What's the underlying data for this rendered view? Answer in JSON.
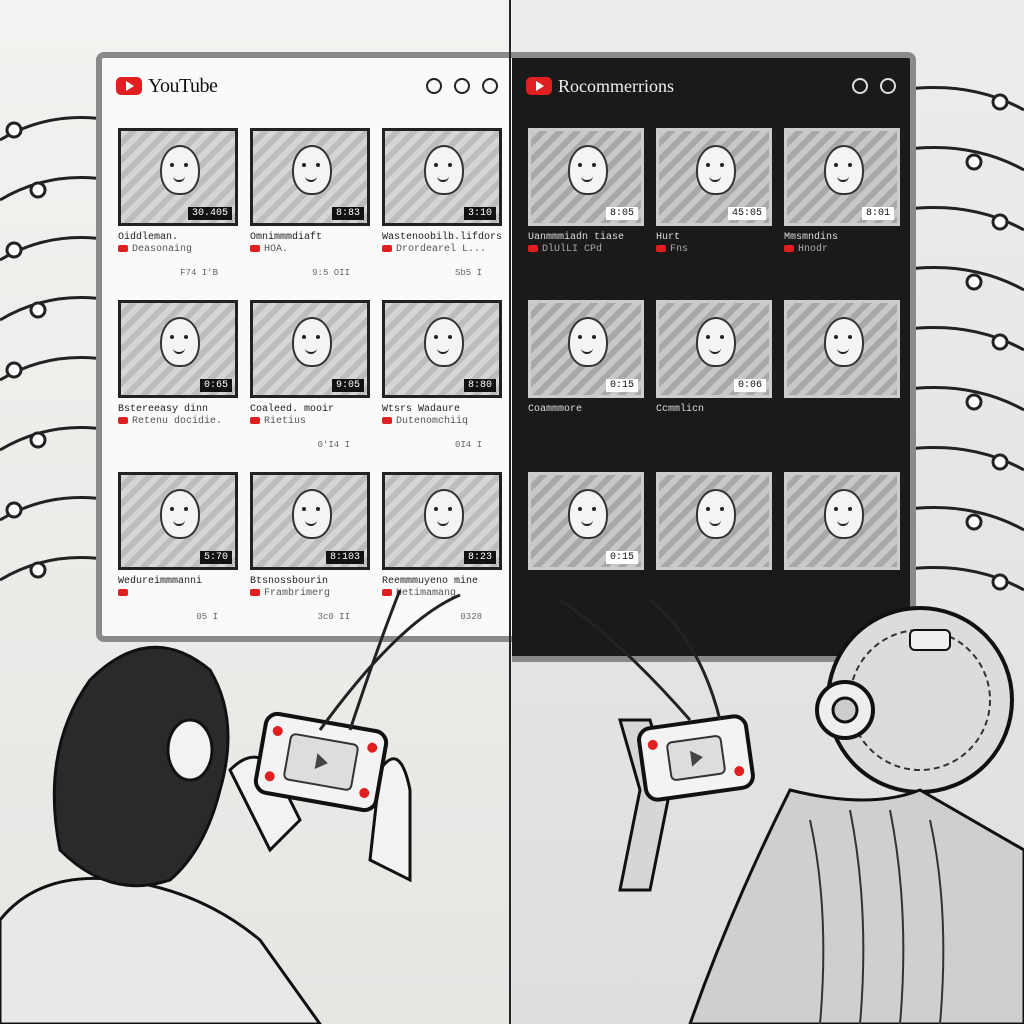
{
  "left_screen": {
    "brand": "YouTube",
    "videos": [
      {
        "duration": "30.405",
        "title": "Oiddleman.",
        "channel": "Deasonaing",
        "stats": "F74 I'B"
      },
      {
        "duration": "8:83",
        "title": "Omnimmmdiaft",
        "channel": "HOA.",
        "stats": "9:5 OII"
      },
      {
        "duration": "3:10",
        "title": "Wastenoobilb.lifdors",
        "channel": "Drordearel L...",
        "stats": "Sb5 I"
      },
      {
        "duration": "0:65",
        "title": "Bstereeasy dinn",
        "channel": "Retenu docidie.",
        "stats": ""
      },
      {
        "duration": "9:05",
        "title": "Coaleed. mooir",
        "channel": "Rietius",
        "stats": "0'I4 I"
      },
      {
        "duration": "8:80",
        "title": "Wtsrs Wadaure",
        "channel": "Dutenomchiiq",
        "stats": "0I4 I"
      },
      {
        "duration": "5:70",
        "title": "Wedureimmmanni",
        "channel": "",
        "stats": "05 I"
      },
      {
        "duration": "8:103",
        "title": "Btsnossbourin",
        "channel": "Frambrimerg",
        "stats": "3c0 II"
      },
      {
        "duration": "8:23",
        "title": "Reemmmuyeno mine",
        "channel": "Hetimamang",
        "stats": "0328"
      }
    ]
  },
  "right_screen": {
    "brand": "Rocommerrions",
    "videos": [
      {
        "duration": "8:05",
        "title": "Uanmmmiadn tiase",
        "channel": "DlUlLI CPd",
        "stats": ""
      },
      {
        "duration": "45:05",
        "title": "Hurt",
        "channel": "Fns",
        "stats": ""
      },
      {
        "duration": "8:01",
        "title": "Mmsmndins",
        "channel": "Hnodr",
        "stats": ""
      },
      {
        "duration": "0:15",
        "title": "Coammmore",
        "channel": "",
        "stats": ""
      },
      {
        "duration": "0:06",
        "title": "Ccmmlicn",
        "channel": "",
        "stats": ""
      },
      {
        "duration": "",
        "title": "",
        "channel": "",
        "stats": ""
      },
      {
        "duration": "0:15",
        "title": "",
        "channel": "",
        "stats": ""
      },
      {
        "duration": "",
        "title": "",
        "channel": "",
        "stats": ""
      },
      {
        "duration": "",
        "title": "",
        "channel": "",
        "stats": ""
      }
    ]
  },
  "colors": {
    "accent": "#e02020",
    "ink": "#111111",
    "paper": "#f4f4f2"
  },
  "icons": [
    "youtube-logo-icon",
    "search-icon",
    "settings-icon",
    "play-icon"
  ]
}
